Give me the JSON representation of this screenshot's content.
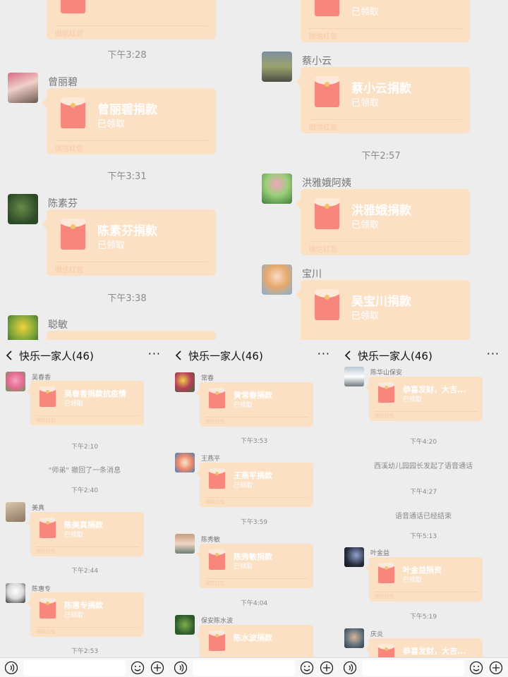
{
  "top": {
    "left": {
      "partial_card": {
        "label": "微信红包"
      },
      "time1": "下午3:28",
      "msg1": {
        "name": "曾丽碧",
        "title": "曾丽碧捐款",
        "status": "已领取",
        "label": "微信红包"
      },
      "time2": "下午3:31",
      "msg2": {
        "name": "陈素芬",
        "title": "陈素芬捐款",
        "status": "已领取",
        "label": "微信红包"
      },
      "time3": "下午3:38",
      "msg3": {
        "name": "聪敏"
      }
    },
    "right": {
      "partial_card": {
        "status": "已领取",
        "label": "微信红包"
      },
      "msg1": {
        "name": "蔡小云",
        "title": "蔡小云捐款",
        "status": "已领取",
        "label": "微信红包"
      },
      "time1": "下午2:57",
      "msg2": {
        "name": "洪雅娥阿姨",
        "title": "洪雅娥捐款",
        "status": "已领取",
        "label": "微信红包"
      },
      "msg3": {
        "name": "宝川",
        "title": "吴宝川捐款",
        "status": "已领取"
      }
    }
  },
  "panels": [
    {
      "title": "快乐一家人(46)",
      "items": [
        {
          "type": "msg",
          "name": "吴春香",
          "title": "吴春香捐款抗疫情",
          "status": "已领取",
          "label": "微信红包"
        },
        {
          "type": "time",
          "text": "下午2:10"
        },
        {
          "type": "sys",
          "text": "\"师弟\" 撤回了一条消息"
        },
        {
          "type": "time",
          "text": "下午2:40"
        },
        {
          "type": "msg",
          "name": "美真",
          "title": "陈美真捐款",
          "status": "已领取",
          "label": "微信红包"
        },
        {
          "type": "time",
          "text": "下午2:44"
        },
        {
          "type": "msg",
          "name": "陈惠专",
          "title": "陈惠专捐款",
          "status": "已领取",
          "label": "微信红包"
        },
        {
          "type": "time",
          "text": "下午2:53"
        }
      ]
    },
    {
      "title": "快乐一家人(46)",
      "items": [
        {
          "type": "msg",
          "name": "常春",
          "title": "黄常春捐款",
          "status": "已领取",
          "label": "微信红包"
        },
        {
          "type": "time",
          "text": "下午3:53"
        },
        {
          "type": "msg",
          "name": "王燕平",
          "title": "王燕平捐款",
          "status": "已领取",
          "label": "微信红包"
        },
        {
          "type": "time",
          "text": "下午3:59"
        },
        {
          "type": "msg",
          "name": "陈秀敏",
          "title": "陈秀敏捐款",
          "status": "已领取",
          "label": "微信红包"
        },
        {
          "type": "time",
          "text": "下午4:04"
        },
        {
          "type": "msg",
          "name": "保安陈水波",
          "title": "陈水波捐款"
        }
      ]
    },
    {
      "title": "快乐一家人(46)",
      "items": [
        {
          "type": "msg",
          "name": "陈华山保安",
          "title": "恭喜发财，大吉...",
          "status": "已领取",
          "label": "微信红包"
        },
        {
          "type": "time",
          "text": "下午4:20"
        },
        {
          "type": "sys",
          "text": "西溪幼儿园园长发起了语音通话"
        },
        {
          "type": "time",
          "text": "下午4:27"
        },
        {
          "type": "sys",
          "text": "语音通话已经结束"
        },
        {
          "type": "time",
          "text": "下午5:13"
        },
        {
          "type": "msg",
          "name": "叶金益",
          "title": "叶金益捐资",
          "status": "已领取",
          "label": "微信红包"
        },
        {
          "type": "time",
          "text": "下午5:19"
        },
        {
          "type": "msg",
          "name": "庆炎",
          "title": "恭喜发财，大吉..."
        }
      ]
    }
  ],
  "icons": {
    "back": "chevron-left-icon",
    "more": "more-icon",
    "voice": "voice-icon",
    "emoji": "emoji-icon",
    "plus": "plus-icon"
  },
  "colors": {
    "background": "#ededed",
    "red_packet_card": "#fce0c4",
    "envelope": "#f7867d"
  }
}
